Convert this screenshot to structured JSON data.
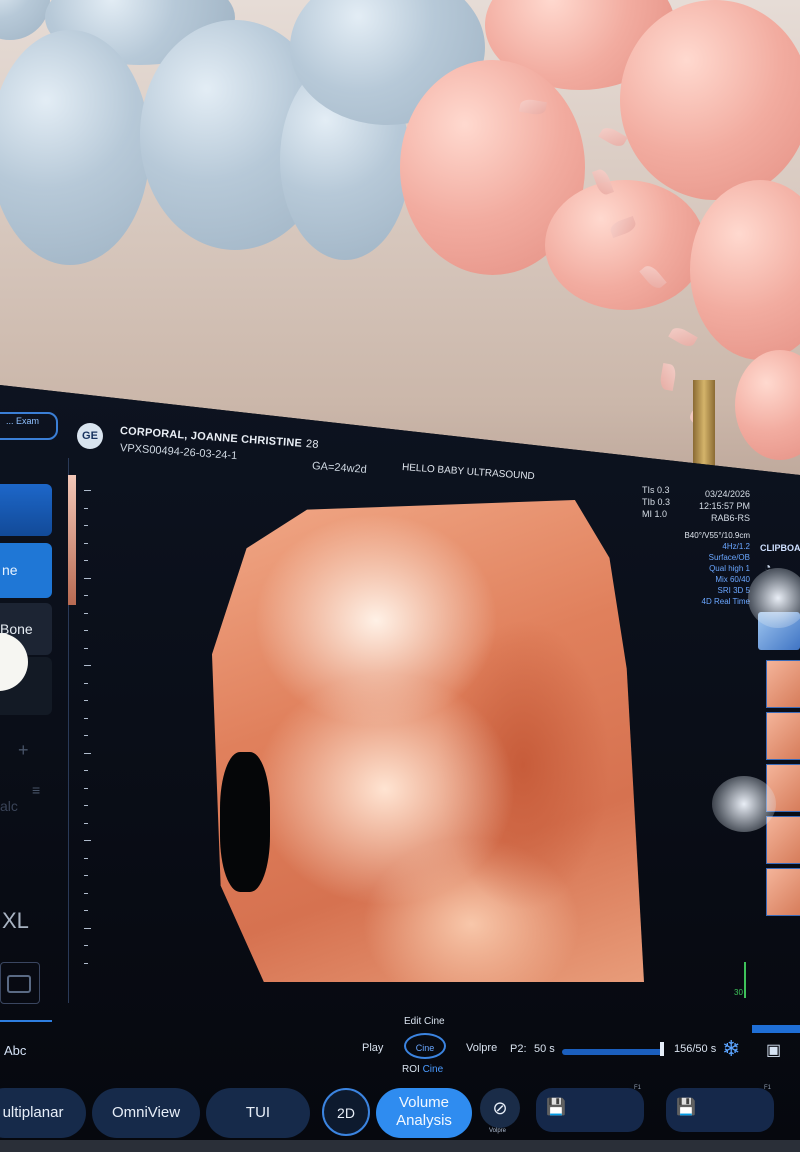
{
  "patient": {
    "name": "CORPORAL, JOANNE CHRISTINE",
    "age": "28",
    "id": "VPXS00494-26-03-24-1",
    "ga": "GA=24w2d"
  },
  "header": {
    "exam_button_label": "... Exam",
    "logo_text": "GE",
    "clinic": "HELLO BABY ULTRASOUND"
  },
  "params": {
    "left": [
      "TIs 0.3",
      "TIb 0.3",
      "MI  1.0"
    ],
    "right": [
      "03/24/2026",
      "12:15:57 PM",
      "RAB6-RS"
    ],
    "mode": [
      "B40°/V55°/10.9cm",
      "4Hz/1.2",
      "Surface/OB",
      "Qual high 1",
      "Mix 60/40",
      "SRI 3D 5",
      "4D Real Time"
    ]
  },
  "sidebar": {
    "items": [
      {
        "label": ""
      },
      {
        "label": "ne"
      },
      {
        "label": "Bone"
      },
      {
        "label": ""
      }
    ],
    "xl_label": "XL",
    "abc_label": "Abc",
    "ale_label": "alc"
  },
  "clipboard": {
    "title": "CLIPBOA"
  },
  "cine": {
    "play": "Play",
    "edit_cine": "Edit Cine",
    "cine_button": "Cine",
    "volpre": "Volpre",
    "roi": "ROI",
    "roi_cine": "Cine",
    "p2": "P2:",
    "p2_value": "50 s",
    "frames": "156/50 s",
    "scale": "30"
  },
  "tabs": {
    "multiplanar": "ultiplanar",
    "omniview": "OmniView",
    "tui": "TUI",
    "two_d": "2D",
    "volume_analysis": "Volume Analysis",
    "volpre_small": "Volpre",
    "f1_a": "F1",
    "f1_b": "F1"
  },
  "colors": {
    "accent": "#2f8cf0",
    "tab_bg": "#162a4a",
    "render": "#e0805c"
  }
}
